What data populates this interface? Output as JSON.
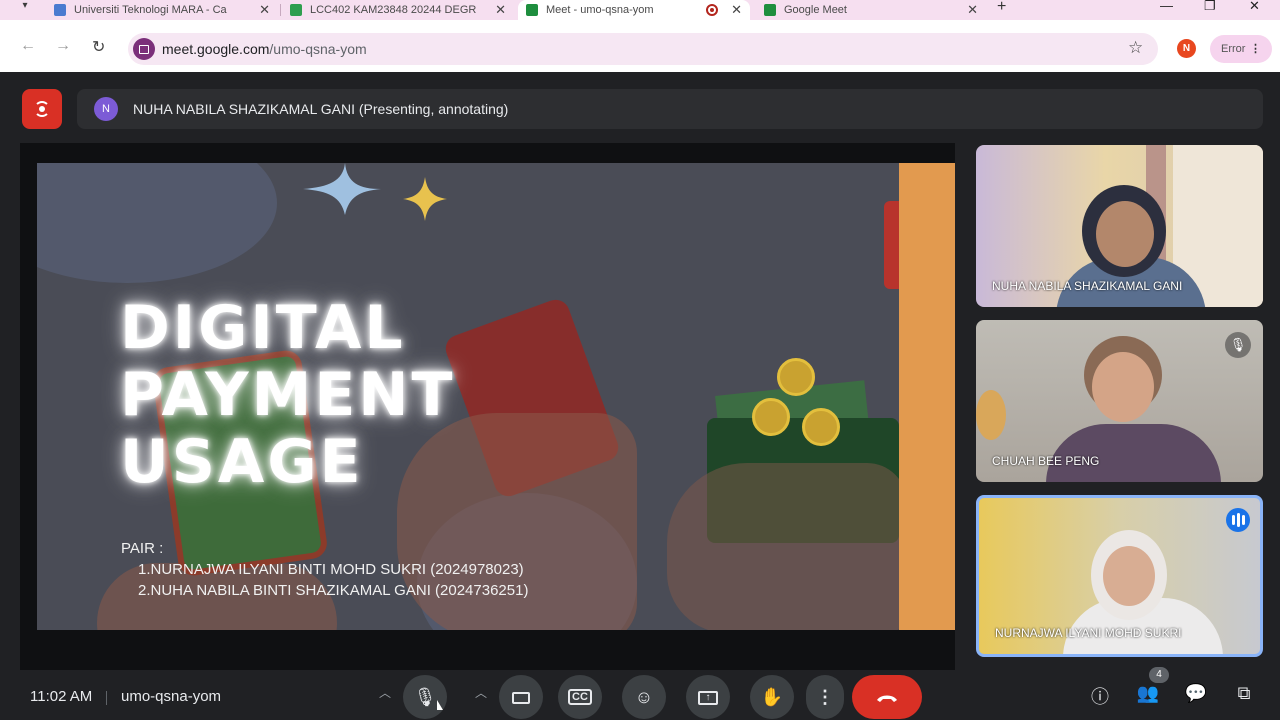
{
  "browser": {
    "tabs": [
      {
        "title": "Universiti Teknologi MARA - Ca",
        "favicon_color": "#4a7bd0",
        "active": false
      },
      {
        "title": "LCC402 KAM23848 20244 DEGR",
        "favicon_color": "#2e9e4f",
        "active": false
      },
      {
        "title": "Meet - umo-qsna-yom",
        "favicon_color": "#1e8e3e",
        "active": true,
        "recording": true
      },
      {
        "title": "Google Meet",
        "favicon_color": "#1e8e3e",
        "active": false
      }
    ],
    "url_host": "meet.google.com",
    "url_path": "/umo-qsna-yom",
    "profile_initial": "N",
    "error_label": "Error"
  },
  "meet": {
    "presenter_initial": "N",
    "presenter_status": "NUHA NABILA SHAZIKAMAL GANI (Presenting, annotating)",
    "slide": {
      "title_lines": [
        "DIGITAL",
        "PAYMENT",
        "USAGE"
      ],
      "pair_label": "PAIR :",
      "pairs": [
        "1.NURNAJWA ILYANI BINTI MOHD SUKRI (2024978023)",
        "2.NUHA NABILA BINTI SHAZIKAMAL GANI (2024736251)"
      ]
    },
    "participants": [
      {
        "name": "NUHA NABILA SHAZIKAMAL GANI",
        "muted": false,
        "speaking": false
      },
      {
        "name": "CHUAH BEE PENG",
        "muted": true,
        "speaking": false
      },
      {
        "name": "NURNAJWA ILYANI MOHD SUKRI",
        "muted": false,
        "speaking": true
      }
    ],
    "time": "11:02 AM",
    "meeting_code": "umo-qsna-yom",
    "people_count": "4",
    "colors": {
      "end_call": "#d93025",
      "live": "#d93025",
      "accent": "#8ab4f8"
    }
  }
}
